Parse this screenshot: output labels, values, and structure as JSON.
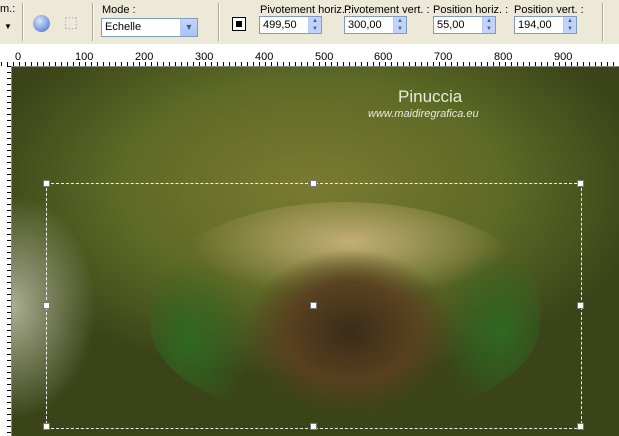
{
  "toolbar": {
    "left_label": "m.:",
    "mode_label": "Mode :",
    "mode_value": "Echelle",
    "fields": [
      {
        "label": "Pivotement horiz. :",
        "value": "499,50"
      },
      {
        "label": "Pivotement vert. :",
        "value": "300,00"
      },
      {
        "label": "Position horiz. :",
        "value": "55,00"
      },
      {
        "label": "Position vert. :",
        "value": "194,00"
      }
    ]
  },
  "ruler": {
    "ticks": [
      "0",
      "100",
      "200",
      "300",
      "400",
      "500",
      "600",
      "700",
      "800",
      "900"
    ]
  },
  "canvas": {
    "title": "Pinuccia",
    "url": "www.maidiregrafica.eu"
  }
}
